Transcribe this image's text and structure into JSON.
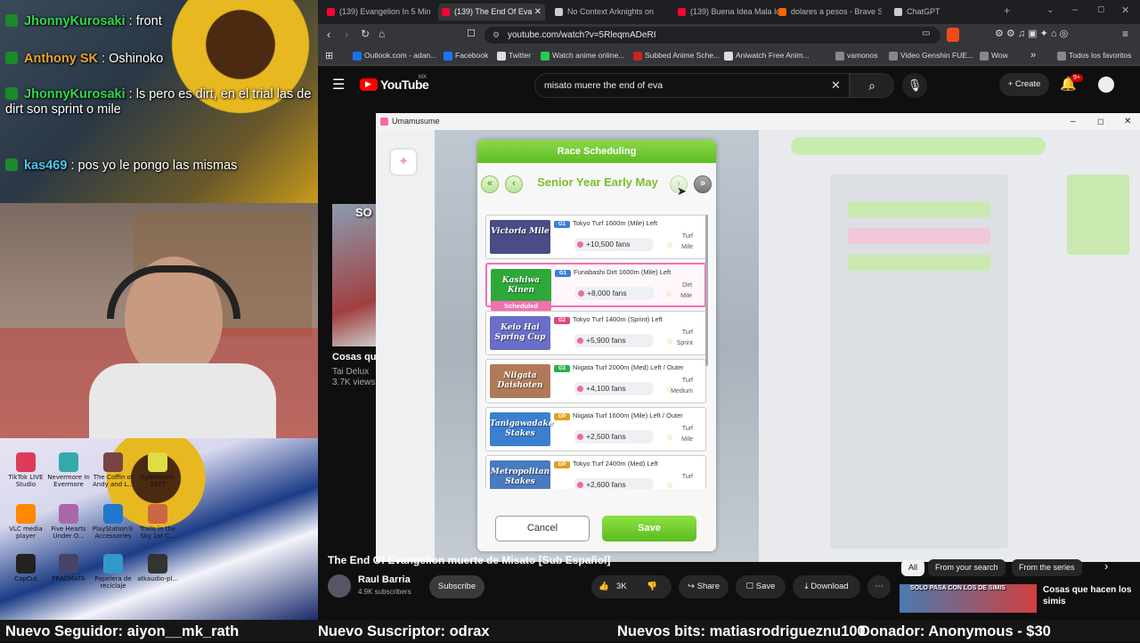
{
  "stream": {
    "chat": [
      {
        "user": "JhonnyKurosaki",
        "text": "front",
        "color": "#2fd84a"
      },
      {
        "user": "Anthony SK",
        "text": "Oshinoko",
        "color": "#e9a42f"
      },
      {
        "user": "JhonnyKurosaki",
        "text": "ls pero es dirt, en el trial las de dirt son sprint o mile",
        "color": "#2fd84a"
      },
      {
        "user": "kas469",
        "text": "pos yo le pongo las mismas",
        "color": "#4fc4e8"
      }
    ],
    "desktop_icons": [
      {
        "label": "TikTok LIVE Studio",
        "color": "#e03a5a"
      },
      {
        "label": "Nevermore In Evermore",
        "color": "#3aa"
      },
      {
        "label": "The Coffin of Andy and L...",
        "color": "#744"
      },
      {
        "label": "Cyberpunk 2077",
        "color": "#dd4"
      },
      {
        "label": "VLC media player",
        "color": "#f80"
      },
      {
        "label": "Five Hearts Under O...",
        "color": "#a6a"
      },
      {
        "label": "PlayStation® Accessories",
        "color": "#27c"
      },
      {
        "label": "Trails in the Sky 1st C...",
        "color": "#c64"
      },
      {
        "label": "CapCut",
        "color": "#222"
      },
      {
        "label": "PRAGMATA",
        "color": "#446"
      },
      {
        "label": "Papelera de reciclaje",
        "color": "#39c"
      },
      {
        "label": "atkaudio-pl...",
        "color": "#333"
      }
    ],
    "ticker": [
      "Nuevo Seguidor: aiyon__mk_rath",
      "Nuevo Suscriptor: odrax",
      "Nuevos bits: matiasrodrigueznu100",
      "Donador: Anonymous - $30"
    ]
  },
  "browser": {
    "tabs": [
      {
        "label": "(139) Evangelion In 5 Min",
        "active": false,
        "color": "#f03"
      },
      {
        "label": "(139) The End Of Eva",
        "active": true,
        "color": "#f03"
      },
      {
        "label": "No Context Arknights on",
        "active": false,
        "color": "#ccc"
      },
      {
        "label": "(139) Buena Idea Mala Ide",
        "active": false,
        "color": "#f03"
      },
      {
        "label": "dolares a pesos - Brave Se",
        "active": false,
        "color": "#f60"
      },
      {
        "label": "ChatGPT",
        "active": false,
        "color": "#ccc"
      }
    ],
    "url": "youtube.com/watch?v=5RleqmADeRI",
    "bookmarks": [
      {
        "label": "Outlook.com - adan...",
        "color": "#1a73e8"
      },
      {
        "label": "Facebook",
        "color": "#1877f2"
      },
      {
        "label": "Twitter",
        "color": "#ddd"
      },
      {
        "label": "Watch anime online...",
        "color": "#2c5"
      },
      {
        "label": "Subbed Anime Sche...",
        "color": "#c22"
      },
      {
        "label": "Aniwatch Free Anim...",
        "color": "#ddd"
      },
      {
        "label": "vamonos",
        "color": "#888"
      },
      {
        "label": "Video Genshin FUE...",
        "color": "#888"
      },
      {
        "label": "Wow",
        "color": "#888"
      },
      {
        "label": "Todos los favoritos",
        "color": "#888"
      }
    ]
  },
  "youtube": {
    "logo": "YouTube",
    "region": "MX",
    "search": "misato muere the end of eva",
    "create": "Create",
    "notifications": "9+",
    "side_card": {
      "title": "Cosas qu",
      "channel": "Tai Delux",
      "views": "3.7K views",
      "badge": "SO"
    },
    "video_title": "The End Of Evangelion muerte de Misato [Sub Español]",
    "channel": "Raul Barria",
    "subscribers": "4.9K subscribers",
    "subscribe": "Subscribe",
    "likes": "3K",
    "share": "Share",
    "save": "Save",
    "download": "Download",
    "chips": [
      "All",
      "From your search",
      "From the series"
    ],
    "rec": {
      "title": "Cosas que hacen los simis",
      "thumb_text": "SOLO PASA CON LOS DE SIMIS"
    }
  },
  "game": {
    "window_title": "Umamusume",
    "dialog_title": "Race Scheduling",
    "date": "Senior Year Early May",
    "races": [
      {
        "banner": "Victoria Mile",
        "grade": "G1",
        "title": "Tokyo Turf 1600m (Mile) Left",
        "fans": "+10,500 fans",
        "surface": "Turf",
        "distance": "Mile",
        "scheduled": false,
        "banner_color": "#4a4c86",
        "grade_color": "#3c7fd8"
      },
      {
        "banner": "Kashiwa Kinen",
        "grade": "G1",
        "title": "Funabashi Dirt 1600m (Mile) Left",
        "fans": "+8,000 fans",
        "surface": "Dirt",
        "distance": "Mile",
        "scheduled": true,
        "banner_color": "#2fa83a",
        "grade_color": "#3c7fd8"
      },
      {
        "banner": "Keio Hai Spring Cup",
        "grade": "G2",
        "title": "Tokyo Turf 1400m (Sprint) Left",
        "fans": "+5,900 fans",
        "surface": "Turf",
        "distance": "Sprint",
        "scheduled": false,
        "banner_color": "#6a6ec8",
        "grade_color": "#e2477f"
      },
      {
        "banner": "Niigata Daishoten",
        "grade": "G3",
        "title": "Niigata Turf 2000m (Med) Left / Outer",
        "fans": "+4,100 fans",
        "surface": "Turf",
        "distance": "Medium",
        "scheduled": false,
        "banner_color": "#b07a5a",
        "grade_color": "#2bb04a"
      },
      {
        "banner": "Tanigawadake Stakes",
        "grade": "OP",
        "title": "Niigata Turf 1600m (Mile) Left / Outer",
        "fans": "+2,500 fans",
        "surface": "Turf",
        "distance": "Mile",
        "scheduled": false,
        "banner_color": "#3a7fd0",
        "grade_color": "#e0a020"
      },
      {
        "banner": "Metropolitan Stakes",
        "grade": "OP",
        "title": "Tokyo Turf 2400m (Med) Left",
        "fans": "+2,600 fans",
        "surface": "Turf",
        "distance": "",
        "scheduled": false,
        "banner_color": "#4a7ac0",
        "grade_color": "#e0a020"
      }
    ],
    "scheduled_label": "Scheduled",
    "cancel": "Cancel",
    "save": "Save"
  }
}
